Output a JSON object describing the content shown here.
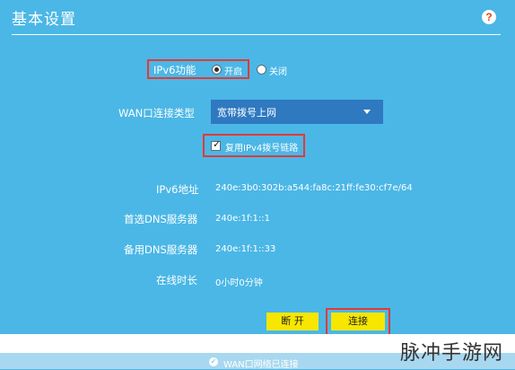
{
  "header": {
    "title": "基本设置",
    "help_icon": "question-mark-icon"
  },
  "ipv6": {
    "label": "IPv6功能",
    "on_label": "开启",
    "off_label": "关闭",
    "selected": "开启"
  },
  "wan": {
    "label": "WAN口连接类型",
    "selected": "宽带拨号上网"
  },
  "reuse": {
    "label": "复用IPv4拨号链路",
    "checked": true
  },
  "info": {
    "ipv6_address_label": "IPv6地址",
    "ipv6_address_value": "240e:3b0:302b:a544:fa8c:21ff:fe30:cf7e/64",
    "primary_dns_label": "首选DNS服务器",
    "primary_dns_value": "240e:1f:1::1",
    "secondary_dns_label": "备用DNS服务器",
    "secondary_dns_value": "240e:1f:1::33",
    "online_time_label": "在线时长",
    "online_time_value": "0小时0分钟"
  },
  "buttons": {
    "disconnect": "断 开",
    "connect": "连接"
  },
  "status": {
    "text": "WAN口网络已连接",
    "icon": "check-circle-icon"
  },
  "watermark": "脉冲手游网",
  "colors": {
    "background": "#4bb7e6",
    "select": "#2f79c1",
    "button": "#f6e600",
    "highlight": "#e23a35"
  }
}
